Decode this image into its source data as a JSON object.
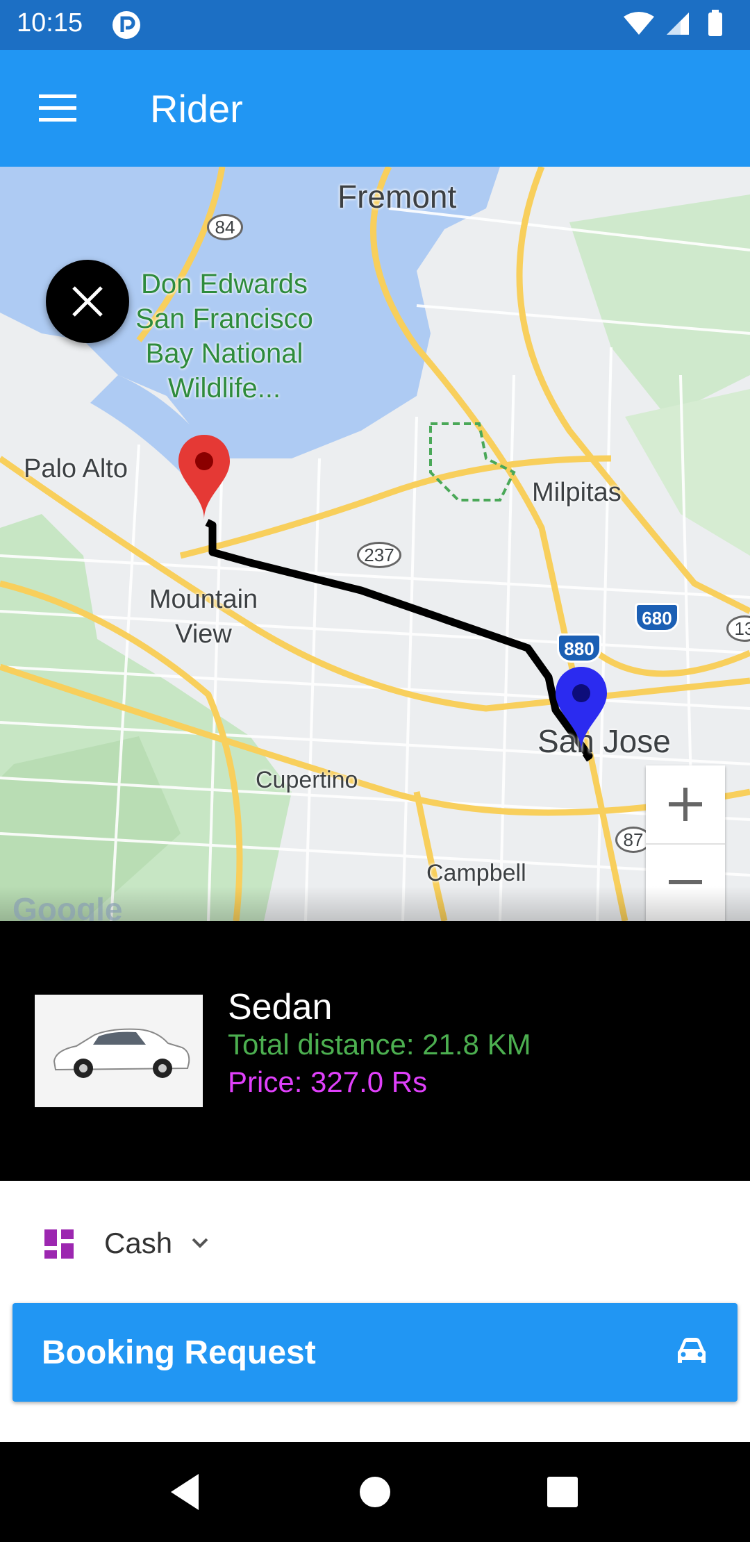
{
  "status_bar": {
    "time": "10:15",
    "icons": [
      "app-notification-icon",
      "wifi-icon",
      "signal-icon",
      "battery-icon"
    ]
  },
  "app_bar": {
    "title": "Rider",
    "menu_icon": "menu-icon"
  },
  "map": {
    "labels": {
      "fremont": "Fremont",
      "park": "Don Edwards San Francisco Bay National Wildlife...",
      "palo_alto": "Palo Alto",
      "milpitas": "Milpitas",
      "mountain_view": "Mountain View",
      "cupertino": "Cupertino",
      "san_jose": "San Jose",
      "campbell": "Campbell",
      "google": "Google"
    },
    "shields": {
      "r84": "84",
      "r237": "237",
      "i880": "880",
      "i680": "680",
      "r87": "87",
      "r13": "13"
    },
    "pickup_marker": "red-marker-icon",
    "dropoff_marker": "blue-marker-icon",
    "zoom_in": "+",
    "zoom_out": "−"
  },
  "ride": {
    "car_type": "Sedan",
    "distance": "Total distance: 21.8 KM",
    "price": "Price: 327.0 Rs"
  },
  "payment": {
    "method": "Cash"
  },
  "booking": {
    "label": "Booking Request"
  },
  "colors": {
    "primary": "#2196f3",
    "status_bar": "#1c6fc4",
    "distance": "#4caf50",
    "price": "#e040fb"
  }
}
